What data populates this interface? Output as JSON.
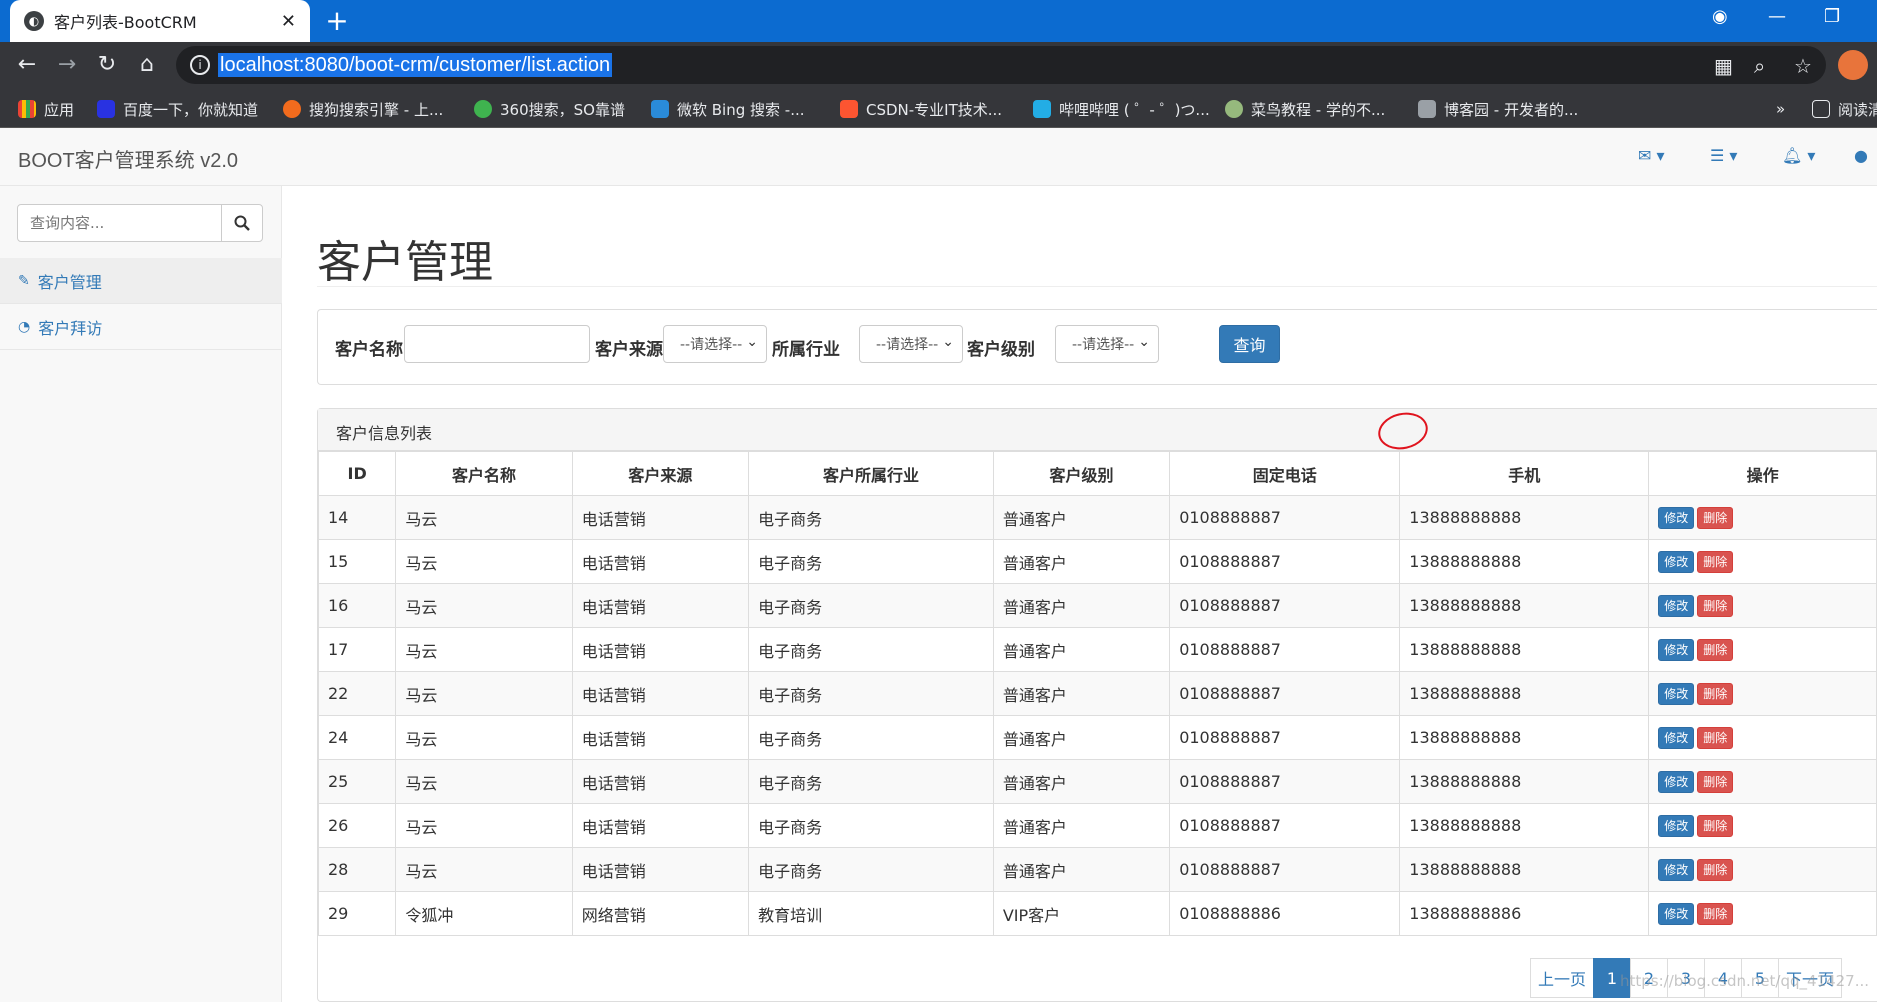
{
  "browser": {
    "tab_title": "客户列表-BootCRM",
    "url": "localhost:8080/boot-crm/customer/list.action",
    "bookmarks": [
      "应用",
      "百度一下，你就知道",
      "搜狗搜索引擎 - 上...",
      "360搜索，SO靠谱",
      "微软 Bing 搜索 -...",
      "CSDN-专业IT技术...",
      "哔哩哔哩 ( ゜- ゜)つ...",
      "菜鸟教程 - 学的不...",
      "博客园 - 开发者的...",
      "»",
      "阅读清单"
    ]
  },
  "app": {
    "brand": "BOOT客户管理系统 v2.0",
    "search_placeholder": "查询内容...",
    "sidebar": [
      {
        "label": "客户管理",
        "icon": "edit-icon"
      },
      {
        "label": "客户拜访",
        "icon": "dashboard-icon"
      }
    ],
    "page_title": "客户管理",
    "filter": {
      "name_label": "客户名称",
      "source_label": "客户来源",
      "industry_label": "所属行业",
      "level_label": "客户级别",
      "select_default": "--请选择--",
      "query_label": "查询"
    },
    "list_heading": "客户信息列表",
    "columns": [
      "ID",
      "客户名称",
      "客户来源",
      "客户所属行业",
      "客户级别",
      "固定电话",
      "手机",
      "操作"
    ],
    "rows": [
      [
        "14",
        "马云",
        "电话营销",
        "电子商务",
        "普通客户",
        "0108888887",
        "13888888888"
      ],
      [
        "15",
        "马云",
        "电话营销",
        "电子商务",
        "普通客户",
        "0108888887",
        "13888888888"
      ],
      [
        "16",
        "马云",
        "电话营销",
        "电子商务",
        "普通客户",
        "0108888887",
        "13888888888"
      ],
      [
        "17",
        "马云",
        "电话营销",
        "电子商务",
        "普通客户",
        "0108888887",
        "13888888888"
      ],
      [
        "22",
        "马云",
        "电话营销",
        "电子商务",
        "普通客户",
        "0108888887",
        "13888888888"
      ],
      [
        "24",
        "马云",
        "电话营销",
        "电子商务",
        "普通客户",
        "0108888887",
        "13888888888"
      ],
      [
        "25",
        "马云",
        "电话营销",
        "电子商务",
        "普通客户",
        "0108888887",
        "13888888888"
      ],
      [
        "26",
        "马云",
        "电话营销",
        "电子商务",
        "普通客户",
        "0108888887",
        "13888888888"
      ],
      [
        "28",
        "马云",
        "电话营销",
        "电子商务",
        "普通客户",
        "0108888887",
        "13888888888"
      ],
      [
        "29",
        "令狐冲",
        "网络营销",
        "教育培训",
        "VIP客户",
        "0108888886",
        "13888888886"
      ]
    ],
    "edit_label": "修改",
    "delete_label": "删除",
    "pagination": [
      "上一页",
      "1",
      "2",
      "3",
      "4",
      "5",
      "下一页"
    ],
    "watermark": "https://blog.csdn.net/qq_41427..."
  },
  "colors": {
    "primary": "#337ab7",
    "danger": "#d9534f",
    "tabbar": "#0c6bd0",
    "annotation": "#e0141e"
  }
}
